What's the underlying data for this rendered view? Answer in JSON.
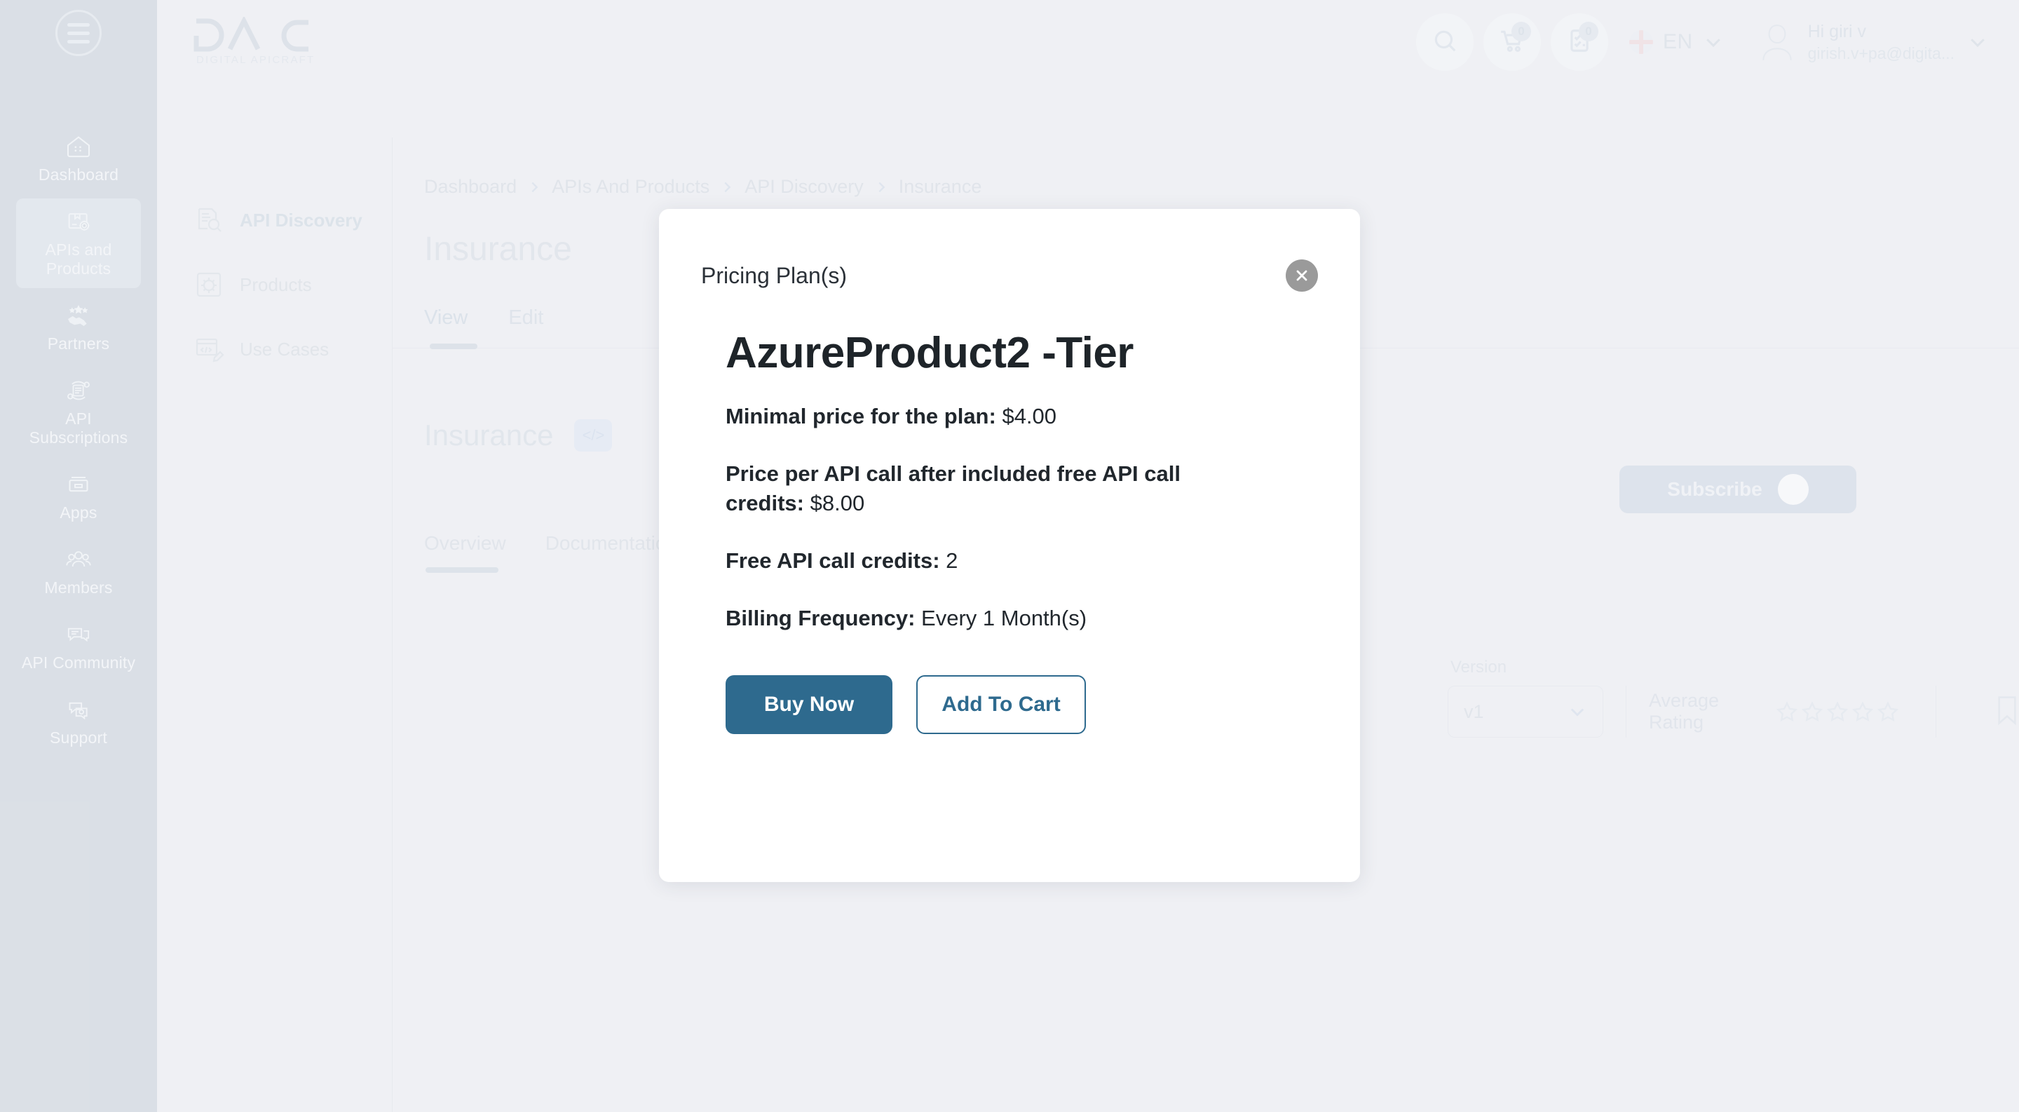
{
  "app": {
    "brand_name": "DAC",
    "brand_tagline": "DIGITAL APICRAFT",
    "accent_color": "#2e6a8e",
    "page_background": "#eff0f4",
    "sidebar_background": "#dadfe6"
  },
  "sidebar": {
    "menu_icon": "hamburger-icon",
    "items": [
      {
        "label": "Dashboard",
        "icon": "dashboard-icon",
        "active": false
      },
      {
        "label": "APIs and Products",
        "icon": "box-gear-icon",
        "active": true
      },
      {
        "label": "Partners",
        "icon": "handshake-icon",
        "active": false
      },
      {
        "label": "API Subscriptions",
        "icon": "subscription-icon",
        "active": false
      },
      {
        "label": "Apps",
        "icon": "apps-icon",
        "active": false
      },
      {
        "label": "Members",
        "icon": "members-icon",
        "active": false
      },
      {
        "label": "API Community",
        "icon": "chat-icon",
        "active": false
      },
      {
        "label": "Support",
        "icon": "support-icon",
        "active": false
      }
    ]
  },
  "header": {
    "search_icon": "search-icon",
    "cart_icon": "cart-icon",
    "cart_count": "0",
    "tasks_icon": "checklist-icon",
    "tasks_count": "0",
    "language": "EN",
    "language_flag": "uk-flag-icon",
    "greeting": "Hi giri v",
    "email": "girish.v+pa@digita..."
  },
  "secondary_sidebar": {
    "items": [
      {
        "label": "API Discovery",
        "icon": "api-discovery-icon",
        "active": true
      },
      {
        "label": "Products",
        "icon": "products-icon",
        "active": false
      },
      {
        "label": "Use Cases",
        "icon": "use-cases-icon",
        "active": false
      }
    ]
  },
  "main": {
    "breadcrumb": [
      "Dashboard",
      "APIs And Products",
      "API Discovery",
      "Insurance"
    ],
    "page_title": "Insurance",
    "view_tabs": [
      {
        "label": "View",
        "active": true
      },
      {
        "label": "Edit",
        "active": false
      }
    ],
    "subscribe_label": "Subscribe",
    "product_name": "Insurance",
    "product_badge_icon": "code-icon",
    "version_label": "Version",
    "version_value": "v1",
    "rating_label": "Average Rating",
    "rating_stars": 5,
    "rating_filled": 0,
    "bookmark_icon": "bookmark-icon",
    "content_tabs": [
      {
        "label": "Overview",
        "active": true
      },
      {
        "label": "Documentation",
        "active": false
      }
    ]
  },
  "modal": {
    "title": "Pricing Plan(s)",
    "close_icon": "close-icon",
    "plan_title": "AzureProduct2 -Tier",
    "details": [
      {
        "label": "Minimal price for the plan:",
        "value": "$4.00"
      },
      {
        "label": "Price per API call after included free API call credits:",
        "value": "$8.00"
      },
      {
        "label": "Free API call credits:",
        "value": "2"
      },
      {
        "label": "Billing Frequency:",
        "value": "Every 1 Month(s)"
      }
    ],
    "buy_now_label": "Buy Now",
    "add_to_cart_label": "Add To Cart"
  }
}
